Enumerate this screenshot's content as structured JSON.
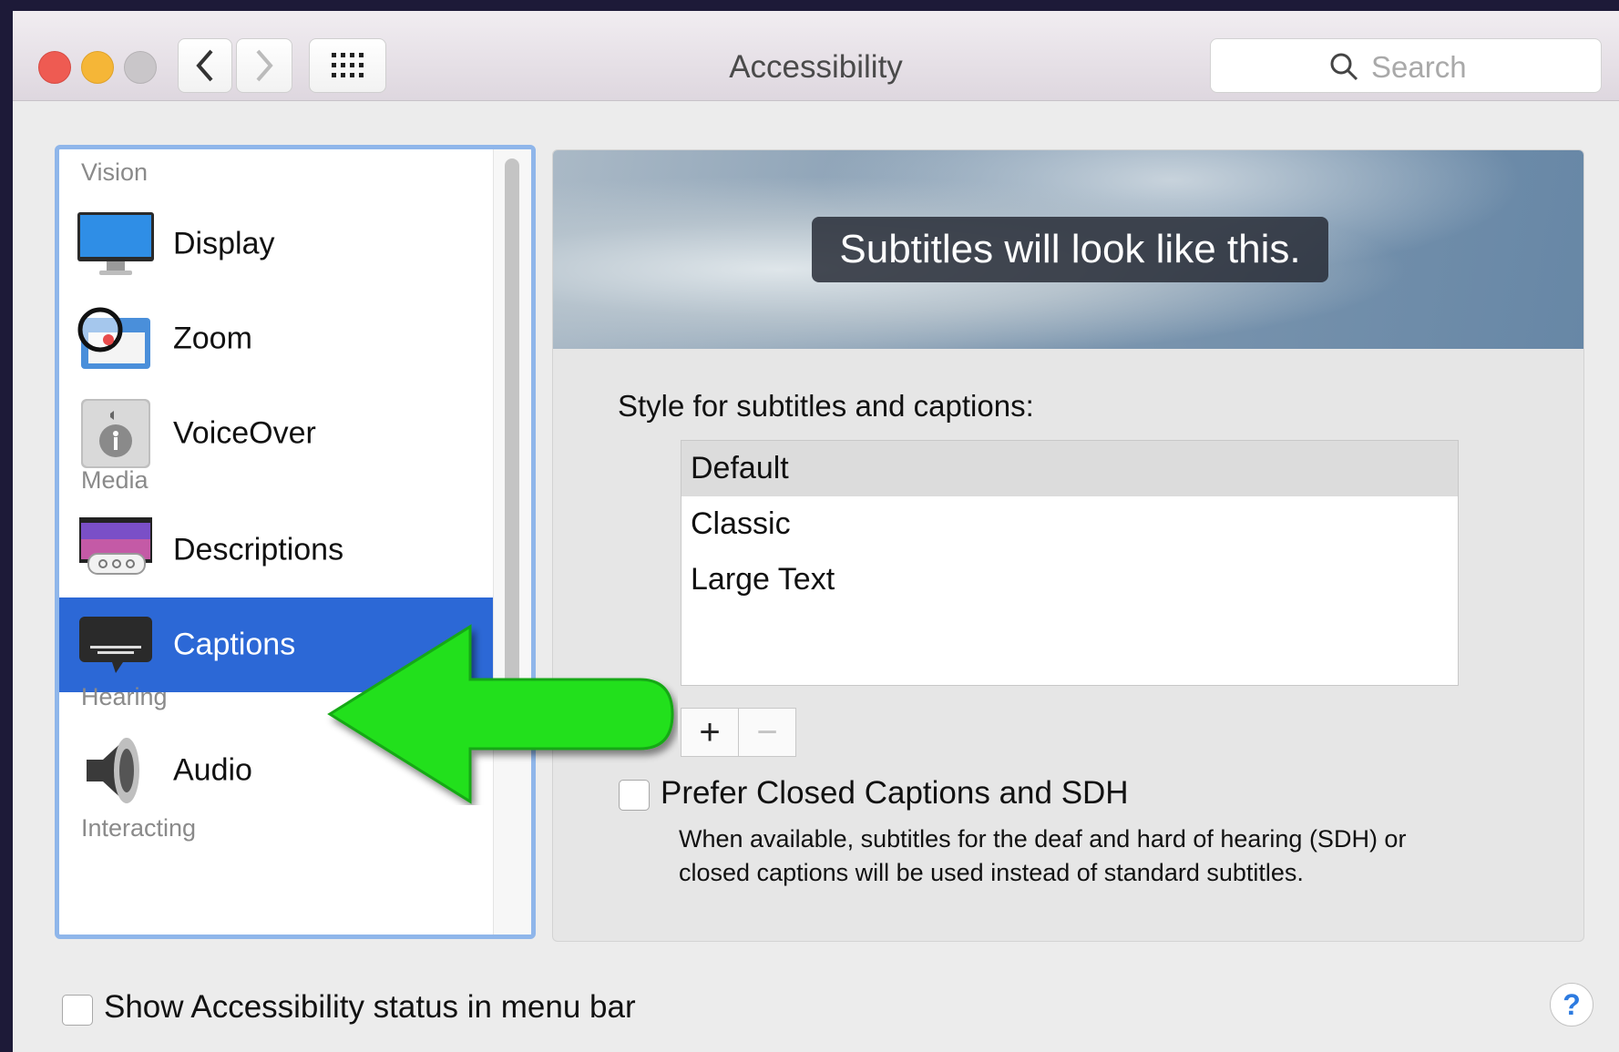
{
  "window": {
    "title": "Accessibility",
    "traffic_lights": {
      "close": "#ee5b52",
      "minimize": "#f5b637",
      "zoom": "#c9c6c9"
    }
  },
  "toolbar": {
    "back_icon": "chevron-left-icon",
    "forward_icon": "chevron-right-icon",
    "grid_icon": "grid-icon"
  },
  "search": {
    "placeholder": "Search"
  },
  "sidebar": {
    "sections": [
      "Vision",
      "Media",
      "Hearing",
      "Interacting"
    ],
    "items": [
      {
        "label": "Display",
        "icon": "display-icon",
        "section": "Vision"
      },
      {
        "label": "Zoom",
        "icon": "zoom-icon",
        "section": "Vision"
      },
      {
        "label": "VoiceOver",
        "icon": "voiceover-icon",
        "section": "Vision"
      },
      {
        "label": "Descriptions",
        "icon": "descriptions-icon",
        "section": "Media"
      },
      {
        "label": "Captions",
        "icon": "captions-icon",
        "section": "Media",
        "selected": true
      },
      {
        "label": "Audio",
        "icon": "audio-icon",
        "section": "Hearing"
      }
    ],
    "selection_color": "#2c68d6"
  },
  "captions": {
    "preview_text": "Subtitles will look like this.",
    "style_label": "Style for subtitles and captions:",
    "styles": [
      "Default",
      "Classic",
      "Large Text"
    ],
    "selected_style": "Default",
    "add_label": "+",
    "remove_label": "−",
    "prefer_cc_label": "Prefer Closed Captions and SDH",
    "prefer_cc_checked": false,
    "prefer_cc_desc": "When available, subtitles for the deaf and hard of hearing (SDH) or closed captions will be used instead of standard subtitles."
  },
  "footer": {
    "status_label": "Show Accessibility status in menu bar",
    "status_checked": false,
    "help_label": "?"
  },
  "annotation": {
    "arrow_color": "#22e01c",
    "arrow_icon": "green-arrow-icon"
  }
}
